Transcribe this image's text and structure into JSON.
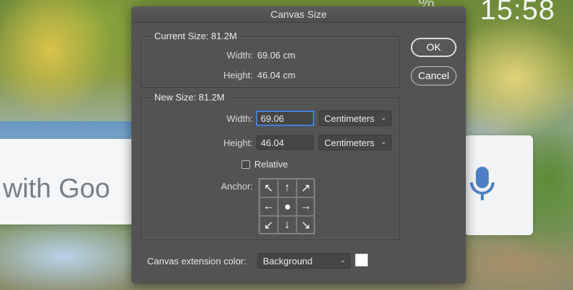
{
  "background": {
    "search_text": "with Goo",
    "clock": "15:58",
    "battery_fragment": "%"
  },
  "dialog": {
    "title": "Canvas Size",
    "current_size": {
      "title": "Current Size: 81.2M",
      "width_label": "Width:",
      "width_value": "69.06 cm",
      "height_label": "Height:",
      "height_value": "46.04 cm"
    },
    "new_size": {
      "title": "New Size: 81.2M",
      "width_label": "Width:",
      "width_value": "69.06",
      "width_unit": "Centimeters",
      "height_label": "Height:",
      "height_value": "46.04",
      "height_unit": "Centimeters",
      "relative_label": "Relative",
      "relative_checked": false,
      "anchor_label": "Anchor:",
      "anchor_arrows": [
        "↖",
        "↑",
        "↗",
        "←",
        "",
        "→",
        "↙",
        "↓",
        "↘"
      ]
    },
    "extension": {
      "label": "Canvas extension color:",
      "value": "Background",
      "swatch_color": "#ffffff"
    },
    "buttons": {
      "ok": "OK",
      "cancel": "Cancel"
    }
  }
}
